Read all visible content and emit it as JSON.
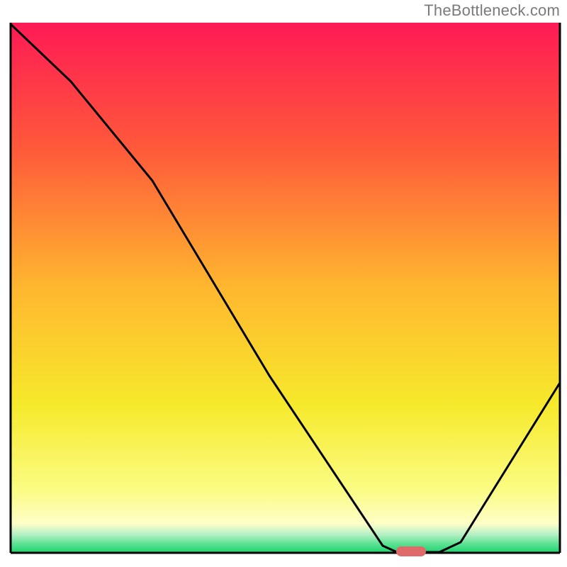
{
  "watermark": "TheBottleneck.com",
  "chart_data": {
    "type": "line",
    "title": "",
    "xlabel": "",
    "ylabel": "",
    "x": [
      15,
      100,
      215,
      380,
      540,
      560,
      590,
      620,
      650,
      790
    ],
    "y": [
      34,
      115,
      255,
      530,
      770,
      779,
      779,
      779,
      765,
      540
    ],
    "xlim": [
      15,
      790
    ],
    "ylim": [
      34,
      780
    ],
    "background_gradient": {
      "stops": [
        {
          "offset": 0.0,
          "color": "#ff1a55"
        },
        {
          "offset": 0.24,
          "color": "#ff5a3a"
        },
        {
          "offset": 0.5,
          "color": "#ffb72f"
        },
        {
          "offset": 0.72,
          "color": "#f6e92b"
        },
        {
          "offset": 0.88,
          "color": "#fbfc82"
        },
        {
          "offset": 0.945,
          "color": "#fefec8"
        },
        {
          "offset": 0.965,
          "color": "#b6f0c5"
        },
        {
          "offset": 0.985,
          "color": "#54e08e"
        },
        {
          "offset": 1.0,
          "color": "#1ed36e"
        }
      ]
    },
    "marker": {
      "present": true,
      "shape": "rounded-rect",
      "center_x": 580,
      "center_y": 778,
      "width": 42,
      "height": 14,
      "color": "#e06a6a"
    },
    "axis_stroke": "#000000",
    "line_stroke": "#000000",
    "line_width": 3
  }
}
